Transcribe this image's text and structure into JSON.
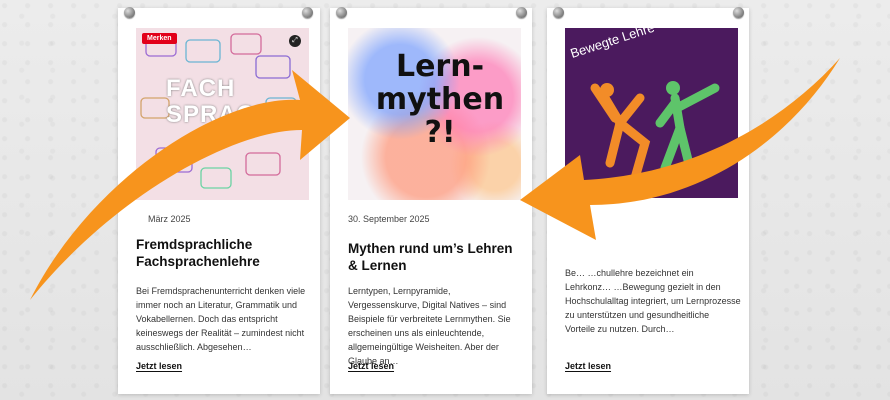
{
  "cards": [
    {
      "badge": "Merken",
      "image_text": "FACH SPRACH",
      "date": "März 2025",
      "title": "Fremdsprachliche Fachsprachenlehre",
      "excerpt": "Bei Fremdsprachenunterricht denken viele immer noch an Literatur, Grammatik und Vokabellernen. Doch das entspricht keineswegs der Realität – zumindest nicht ausschließlich. Abgesehen…",
      "read_more": "Jetzt lesen"
    },
    {
      "image_text": "Lern-mythen ?!",
      "date": "30. September 2025",
      "title": "Mythen rund um’s Lehren & Lernen",
      "excerpt": "Lerntypen, Lernpyramide, Vergessenskurve, Digital Natives – sind Beispiele für verbreitete Lernmythen. Sie erscheinen uns als einleuchtende, allgemeingültige Weisheiten. Aber der Glaube an…",
      "read_more": "Jetzt lesen"
    },
    {
      "image_text": "Bewegte Lehre",
      "excerpt": "Be… …chullehre bezeichnet ein Lehrkonz… …Bewegung gezielt in den Hochschulalltag integriert, um Lernprozesse zu unterstützen und gesundheitliche Vorteile zu nutzen. Durch…",
      "read_more": "Jetzt lesen"
    }
  ],
  "colors": {
    "arrow": "#f7941d",
    "purple": "#4b1a5e",
    "badge": "#e2001a"
  }
}
